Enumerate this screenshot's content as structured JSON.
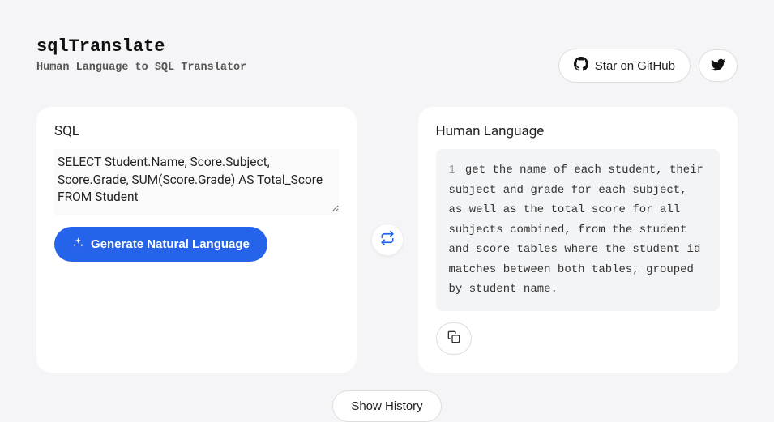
{
  "header": {
    "logo": "sqlTranslate",
    "subtitle": "Human Language to SQL Translator",
    "star_label": "Star on GitHub"
  },
  "left": {
    "title": "SQL",
    "sql_value": "SELECT Student.Name, Score.Subject, Score.Grade, SUM(Score.Grade) AS Total_Score\nFROM Student",
    "generate_label": "Generate Natural Language"
  },
  "right": {
    "title": "Human Language",
    "line_number": "1",
    "output_text": "get the name of each student, their subject and grade for each subject, as well as the total score for all subjects combined, from the student and score tables where the student id matches between both tables, grouped by student name."
  },
  "footer": {
    "history_label": "Show History"
  }
}
